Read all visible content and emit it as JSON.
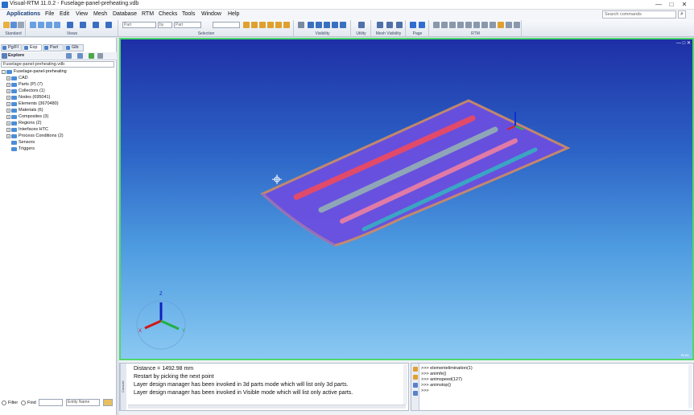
{
  "window": {
    "title": "Visual-RTM 11.0.2 - Fuselage-panel-preheating.vdb",
    "minimize": "—",
    "maximize": "□",
    "close": "✕"
  },
  "menubar": {
    "items": [
      "Applications",
      "File",
      "Edit",
      "View",
      "Mesh",
      "Database",
      "RTM",
      "Checks",
      "Tools",
      "Window",
      "Help"
    ],
    "search_placeholder": "Search commands"
  },
  "toolbar": {
    "groups": [
      "Standard",
      "Views",
      "Selection",
      "Visibility",
      "Utility",
      "Mesh Visibility",
      "Page",
      "RTM"
    ],
    "selection_fields": [
      "Part",
      "by",
      "Part"
    ]
  },
  "left_panel": {
    "tabs": [
      "Pg/Fl",
      "Exp",
      "Part",
      "Glb"
    ],
    "explore_label": "Explore",
    "file_combo": "Fuselage-panel-preheating.vdb",
    "tree": [
      {
        "label": "Fuselage-panel-preheating",
        "level": 0,
        "expander": "-"
      },
      {
        "label": "CAD",
        "level": 1,
        "expander": "+"
      },
      {
        "label": "Parts (P) (7)",
        "level": 1,
        "expander": "+"
      },
      {
        "label": "Collectors (1)",
        "level": 1,
        "expander": "+"
      },
      {
        "label": "Nodes (695041)",
        "level": 1,
        "expander": "+"
      },
      {
        "label": "Elements (3670480)",
        "level": 1,
        "expander": "+"
      },
      {
        "label": "Materials (6)",
        "level": 1,
        "expander": "+"
      },
      {
        "label": "Composites (3)",
        "level": 1,
        "expander": "+"
      },
      {
        "label": "Regions (2)",
        "level": 1,
        "expander": "+"
      },
      {
        "label": "Interfaces HTC",
        "level": 1,
        "expander": "+"
      },
      {
        "label": "Process Conditions (2)",
        "level": 1,
        "expander": "+"
      },
      {
        "label": "Sensors",
        "level": 1,
        "expander": ""
      },
      {
        "label": "Triggers",
        "level": 1,
        "expander": ""
      }
    ],
    "filter": {
      "filter_label": "Filter",
      "find_label": "Find",
      "entity_combo": "Entity Name"
    }
  },
  "viewport": {
    "axis_labels": {
      "x": "X",
      "y": "Y",
      "z": "Z"
    },
    "corner_label": "Pin#1"
  },
  "messages": {
    "tab_label": "Console",
    "lines": [
      "Distance = 1492.98 mm",
      "Restart by picking the next point",
      "Layer design manager has been invoked in 3d parts mode which will list only 3d parts.",
      "Layer design manager has been invoked in Visible mode which will list only active parts."
    ]
  },
  "command_history": {
    "lines": [
      ">>> elementelimination(1)",
      ">>> animfe()",
      ">>> animspeed(127)",
      ">>> animstop()",
      ">>>"
    ]
  },
  "colors": {
    "viewport_border": "#4fd86a",
    "panel_purple": "#6b4fe0",
    "stringer_red": "#e24a6a",
    "stringer_gray": "#8fa6b8",
    "stringer_pink": "#e07aa6",
    "stringer_teal": "#3aa6c4"
  }
}
